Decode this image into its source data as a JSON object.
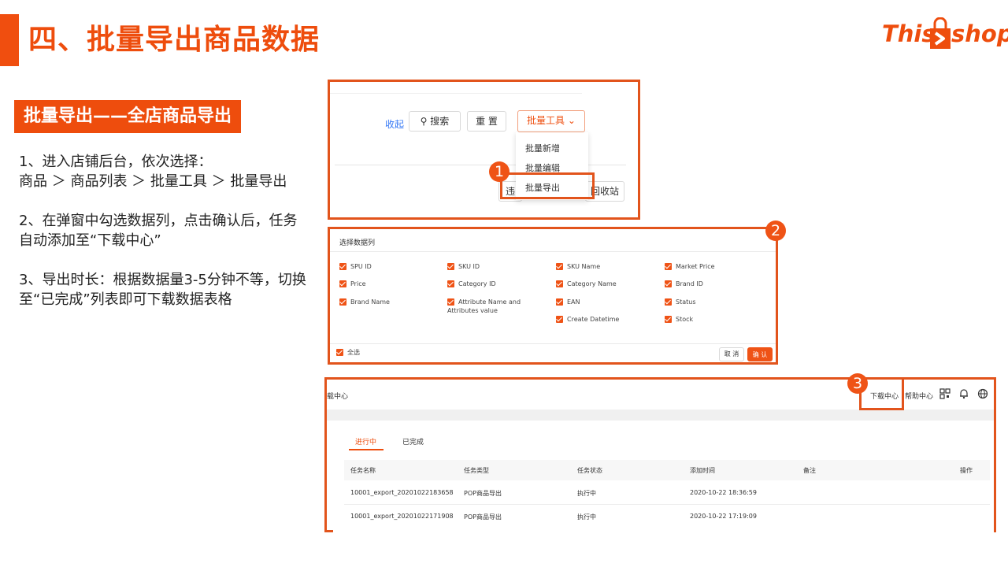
{
  "header": {
    "title": "四、批量导出商品数据",
    "logo_this": "This",
    "logo_shop": "shop",
    "brand_color": "#ee4d0d"
  },
  "left": {
    "subtitle": "批量导出——全店商品导出",
    "step1_line1": "1、进入店铺后台，依次选择：",
    "step1_line2": "商品  ＞ 商品列表 ＞ 批量工具 ＞ 批量导出",
    "step2": "2、在弹窗中勾选数据列，点击确认后，任务自动添加至“下载中心”",
    "step3": "3、导出时长：根据数据量3-5分钟不等，切换至“已完成”列表即可下载数据表格"
  },
  "panel1": {
    "badge": "1",
    "collapse": "收起",
    "search_label": "搜索",
    "reset_label": "重 置",
    "tools_label": "批量工具",
    "menu": [
      "批量新增",
      "批量编辑",
      "批量导出"
    ],
    "btn_left": "违",
    "btn_right": "回收站"
  },
  "panel2": {
    "badge": "2",
    "title": "选择数据列",
    "columns": [
      [
        "SPU ID",
        "Price",
        "Brand Name"
      ],
      [
        "SKU ID",
        "Category ID",
        "Attribute Name and Attributes value"
      ],
      [
        "SKU Name",
        "Category Name",
        "EAN",
        "Create Datetime"
      ],
      [
        "Market Price",
        "Brand ID",
        "Status",
        "Stock"
      ]
    ],
    "select_all": "全选",
    "cancel": "取 消",
    "confirm": "确 认"
  },
  "panel3": {
    "badge": "3",
    "crumb": "载中心",
    "nav_download": "下载中心",
    "nav_help": "帮助中心",
    "tab_active": "进行中",
    "tab_done": "已完成",
    "headers": [
      "任务名称",
      "任务类型",
      "任务状态",
      "添加时间",
      "备注",
      "操作"
    ],
    "rows": [
      [
        "10001_export_20201022183658",
        "POP商品导出",
        "执行中",
        "2020-10-22 18:36:59",
        "",
        ""
      ],
      [
        "10001_export_20201022171908",
        "POP商品导出",
        "执行中",
        "2020-10-22 17:19:09",
        "",
        ""
      ]
    ]
  }
}
